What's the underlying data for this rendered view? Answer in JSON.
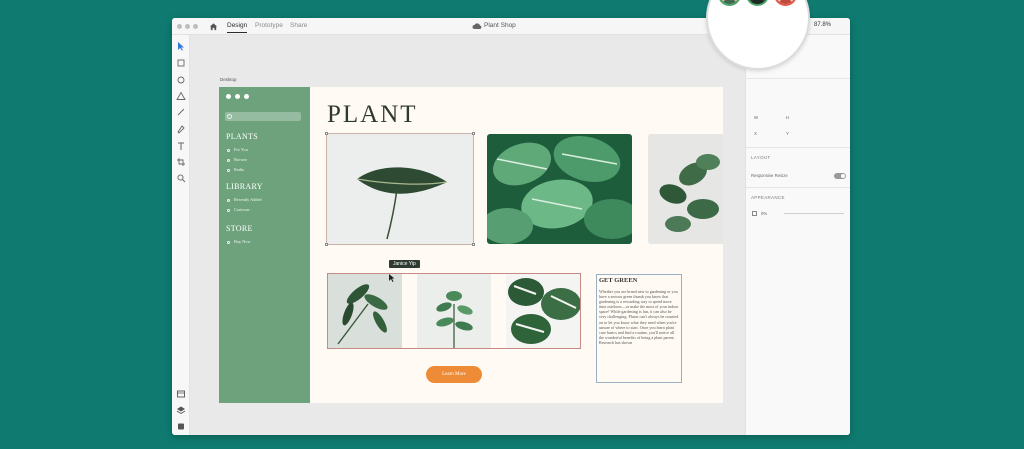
{
  "window": {
    "tabs": [
      {
        "label": "Design",
        "active": true
      },
      {
        "label": "Prototype",
        "active": false
      },
      {
        "label": "Share",
        "active": false
      }
    ],
    "document_title": "Plant Shop",
    "zoom": "87.8%"
  },
  "canvas": {
    "artboard_label": "Desktop"
  },
  "sidebar": {
    "sections": [
      {
        "heading": "PLANTS",
        "items": [
          "For You",
          "Browse",
          "Radio"
        ]
      },
      {
        "heading": "LIBRARY",
        "items": [
          "Recently Added",
          "Cartoons"
        ]
      },
      {
        "heading": "STORE",
        "items": [
          "Buy Now"
        ]
      }
    ]
  },
  "main": {
    "title": "PLANT",
    "tooltip": "Janice Yip",
    "text_block": {
      "heading": "GET GREEN",
      "body": "Whether you are brand new to gardening or you have a serious green thumb you know that gardening is a rewarding way to spend more time outdoors—or make the most of your indoor space! While gardening is fun, it can also be very challenging. Plants can't always be counted on to let you know what they need when you're unsure of where to start. Once you learn plant care basics and find a routine, you'll notice all the wonderful benefits of being a plant parent. Research has shown"
    },
    "cta_label": "Learn More"
  },
  "properties": {
    "responsive_resize_label": "Responsive Resize",
    "section_labels": [
      "LAYOUT",
      "APPEARANCE"
    ],
    "fields": [
      "W",
      "H",
      "X",
      "Y"
    ],
    "opacity": "0%"
  },
  "colors": {
    "background": "#0f7b70",
    "sidebar": "#6da27c",
    "artboard": "#fffbf4",
    "cta": "#ee8b37",
    "presence_ring": "#4aa36a"
  }
}
